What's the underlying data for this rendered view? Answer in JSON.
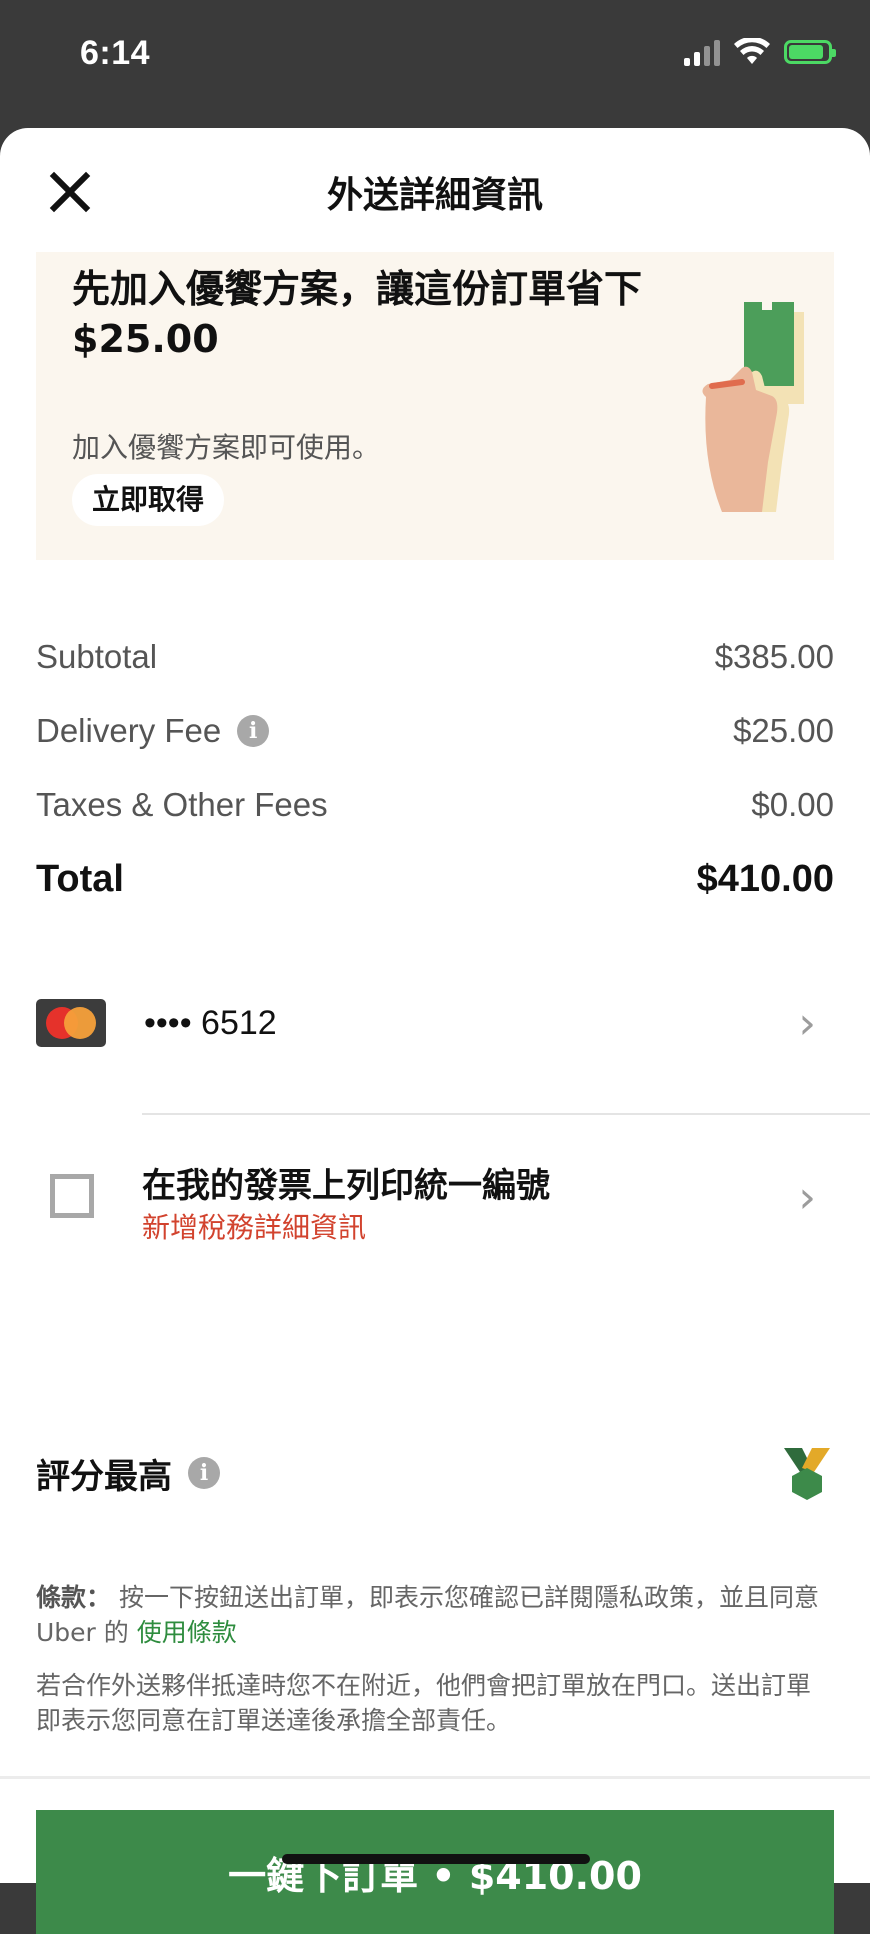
{
  "status_bar": {
    "time": "6:14"
  },
  "header": {
    "title": "外送詳細資訊"
  },
  "promo": {
    "title": "先加入優饗方案，讓這份訂單省下 $25.00",
    "subtitle": "加入優饗方案即可使用。",
    "button_label": "立即取得"
  },
  "fees": {
    "subtotal_label": "Subtotal",
    "subtotal_value": "$385.00",
    "delivery_label": "Delivery Fee",
    "delivery_value": "$25.00",
    "taxes_label": "Taxes & Other Fees",
    "taxes_value": "$0.00",
    "total_label": "Total",
    "total_value": "$410.00"
  },
  "payment": {
    "card_masked": "•••• 6512"
  },
  "tax": {
    "title": "在我的發票上列印統一編號",
    "subtitle": "新增稅務詳細資訊"
  },
  "rating": {
    "title": "評分最高"
  },
  "terms": {
    "label": "條款：",
    "text": "按一下按鈕送出訂單，即表示您確認已詳閱隱私政策，並且同意 Uber 的",
    "link": "使用條款",
    "notice": "若合作外送夥伴抵達時您不在附近，他們會把訂單放在門口。送出訂單即表示您同意在訂單送達後承擔全部責任。"
  },
  "order_button": {
    "label": "一鍵下訂單 • $410.00"
  },
  "colors": {
    "accent_green": "#3d8a4a",
    "link_green": "#2e8c3e",
    "alert_red": "#d2432e",
    "promo_bg": "#fbf6ee"
  },
  "icons": [
    "close-icon",
    "info-icon",
    "mastercard-icon",
    "chevron-right-icon",
    "checkbox-icon",
    "medal-icon",
    "signal-icon",
    "wifi-icon",
    "battery-icon"
  ]
}
